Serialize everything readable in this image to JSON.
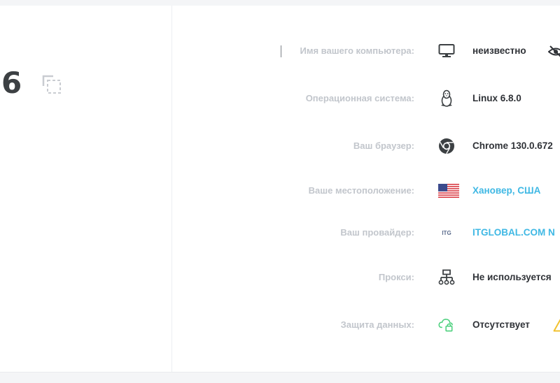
{
  "ip": {
    "visible_digit": "6"
  },
  "rows": [
    {
      "label": "Имя вашего компьютера:",
      "value": "неизвестно",
      "icon": "monitor-icon"
    },
    {
      "label": "Операционная система:",
      "value": "Linux 6.8.0",
      "icon": "linux-tux-icon"
    },
    {
      "label": "Ваш браузер:",
      "value": "Chrome 130.0.672",
      "icon": "chrome-icon"
    },
    {
      "label": "Ваше местоположение:",
      "value": "Хановер, США",
      "icon": "us-flag-icon"
    },
    {
      "label": "Ваш провайдер:",
      "value": "ITGLOBAL.COM N",
      "icon": "itg-logo-icon",
      "icon_text": "ITG"
    },
    {
      "label": "Прокси:",
      "value": "Не используется",
      "icon": "network-icon"
    },
    {
      "label": "Защита данных:",
      "value": "Отсутствует",
      "icon": "cloud-lock-icon"
    }
  ],
  "colors": {
    "label": "#c2c6cc",
    "value": "#2f3237",
    "link": "#3fb8e4",
    "protection": "#4cd07d",
    "warning": "#f2c230"
  }
}
